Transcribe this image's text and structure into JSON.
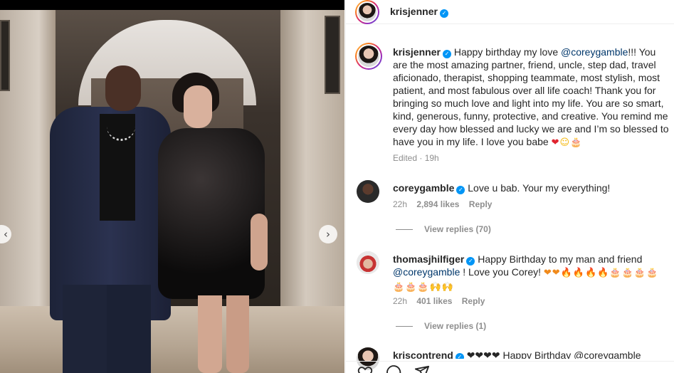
{
  "post": {
    "username": "krisjenner",
    "caption_text": "Happy birthday my love @coreygamble!!! You are the most amazing partner, friend, uncle, step dad, travel aficionado, therapist, shopping teammate, most stylish, most patient, and most fabulous over all life coach! Thank you for bringing so much love and light into my life. You are so smart, kind, generous, funny, protective, and creative. You remind me every day how blessed and lucky we are and I’m so blessed to have you in my life. I love you babe",
    "caption_lead": "Happy birthday my love ",
    "caption_mention": "@coreygamble",
    "caption_rest": "!!! You are the most amazing partner, friend, uncle, step dad, travel aficionado, therapist, shopping teammate, most stylish, most patient, and most fabulous over all life coach! Thank you for bringing so much love and light into my life. You are so smart, kind, generous, funny, protective, and creative. You remind me every day how blessed and lucky we are and I’m so blessed to have you in my life. I love you babe ",
    "caption_emoji": [
      "❤",
      "☺",
      "🎂"
    ],
    "edited_label": "Edited",
    "time": "19h"
  },
  "comments": [
    {
      "username": "coreygamble",
      "text": "Love u bab. Your my everything!",
      "time": "22h",
      "likes": "2,894 likes",
      "reply_label": "Reply",
      "view_replies": "View replies (70)"
    },
    {
      "username": "thomasjhilfiger",
      "text_lead": "Happy Birthday to my man and friend",
      "mention": "@coreygamble",
      "text_rest": " ! Love you Corey! ",
      "emoji_line1": "❤❤🔥🔥🔥🔥🎂🎂🎂🎂",
      "emoji_line2": "🎂🎂🎂🙌🙌",
      "time": "22h",
      "likes": "401 likes",
      "reply_label": "Reply",
      "view_replies": "View replies (1)"
    },
    {
      "username": "kriscontrend",
      "text_preview": "❤❤❤❤ Happy Birthday @coreygamble"
    }
  ],
  "icons": {
    "verified": "verified-badge-icon",
    "carousel_prev": "chevron-left-icon",
    "carousel_next": "chevron-right-icon",
    "like": "heart-outline-icon",
    "comment": "comment-bubble-icon",
    "share": "paper-plane-icon"
  },
  "colors": {
    "verified_blue": "#0095f6",
    "mention": "#00376b",
    "muted": "#8e8e8e",
    "text": "#262626"
  }
}
